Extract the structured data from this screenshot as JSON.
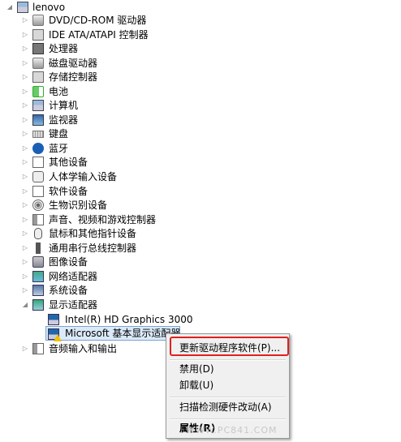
{
  "root": {
    "label": "lenovo",
    "expander": "◢",
    "icon": "computer-icon"
  },
  "categories": [
    {
      "label": "DVD/CD-ROM 驱动器",
      "icon": "dvd-drive-icon"
    },
    {
      "label": "IDE ATA/ATAPI 控制器",
      "icon": "ide-controller-icon"
    },
    {
      "label": "处理器",
      "icon": "processor-icon"
    },
    {
      "label": "磁盘驱动器",
      "icon": "disk-drive-icon"
    },
    {
      "label": "存储控制器",
      "icon": "storage-controller-icon"
    },
    {
      "label": "电池",
      "icon": "battery-icon"
    },
    {
      "label": "计算机",
      "icon": "computer-icon"
    },
    {
      "label": "监视器",
      "icon": "monitor-icon"
    },
    {
      "label": "键盘",
      "icon": "keyboard-icon"
    },
    {
      "label": "蓝牙",
      "icon": "bluetooth-icon"
    },
    {
      "label": "其他设备",
      "icon": "other-devices-icon"
    },
    {
      "label": "人体学输入设备",
      "icon": "hid-icon"
    },
    {
      "label": "软件设备",
      "icon": "software-device-icon"
    },
    {
      "label": "生物识别设备",
      "icon": "biometric-icon"
    },
    {
      "label": "声音、视频和游戏控制器",
      "icon": "sound-icon"
    },
    {
      "label": "鼠标和其他指针设备",
      "icon": "mouse-icon"
    },
    {
      "label": "通用串行总线控制器",
      "icon": "usb-icon"
    },
    {
      "label": "图像设备",
      "icon": "camera-icon"
    },
    {
      "label": "网络适配器",
      "icon": "network-adapter-icon"
    },
    {
      "label": "系统设备",
      "icon": "system-device-icon"
    }
  ],
  "display_adapters": {
    "label": "显示适配器",
    "icon": "display-adapter-icon",
    "expander": "◢",
    "children": [
      {
        "label": "Intel(R) HD Graphics 3000",
        "icon": "display-device-icon"
      },
      {
        "label": "Microsoft 基本显示适配器",
        "icon": "display-device-warning-icon"
      }
    ]
  },
  "last_category": {
    "label": "音频输入和输出",
    "icon": "audio-io-icon"
  },
  "collapsed_expander": "▷",
  "context_menu": {
    "items": [
      {
        "label": "更新驱动程序软件(P)..."
      },
      {
        "label": "禁用(D)"
      },
      {
        "label": "卸载(U)"
      },
      {
        "label": "扫描检测硬件改动(A)"
      },
      {
        "label": "属性(R)"
      }
    ]
  },
  "watermark": "WWW.PC841.COM",
  "colors": {
    "highlight_border": "#e02020",
    "selection": "#dbe9f9"
  }
}
